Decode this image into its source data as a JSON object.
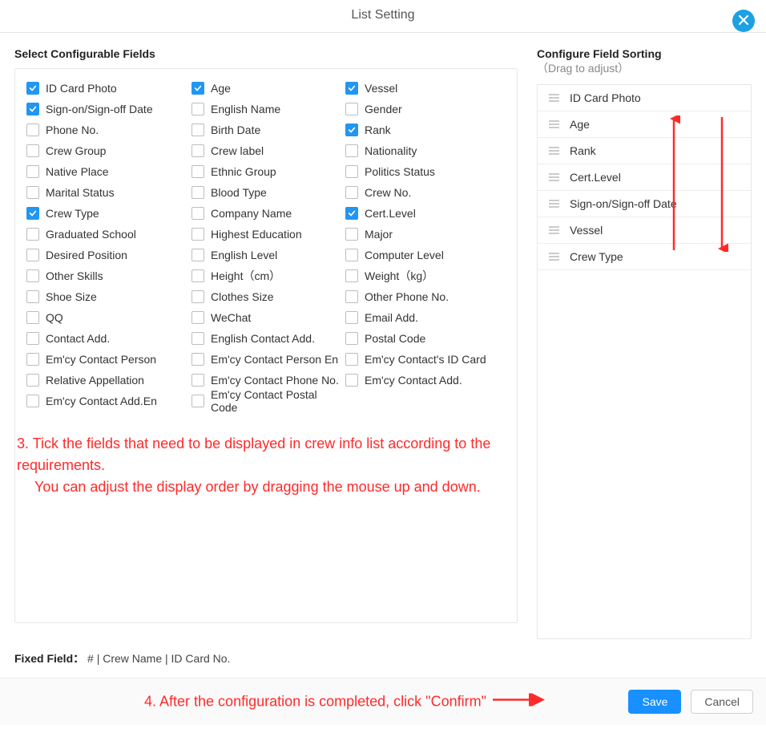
{
  "header": {
    "title": "List Setting"
  },
  "left": {
    "title": "Select Configurable Fields",
    "fields": [
      {
        "label": "ID Card Photo",
        "checked": true
      },
      {
        "label": "Age",
        "checked": true
      },
      {
        "label": "Vessel",
        "checked": true
      },
      {
        "label": "Sign-on/Sign-off Date",
        "checked": true
      },
      {
        "label": "English Name",
        "checked": false
      },
      {
        "label": "Gender",
        "checked": false
      },
      {
        "label": "Phone No.",
        "checked": false
      },
      {
        "label": "Birth Date",
        "checked": false
      },
      {
        "label": "Rank",
        "checked": true
      },
      {
        "label": "Crew Group",
        "checked": false
      },
      {
        "label": "Crew label",
        "checked": false
      },
      {
        "label": "Nationality",
        "checked": false
      },
      {
        "label": "Native Place",
        "checked": false
      },
      {
        "label": "Ethnic Group",
        "checked": false
      },
      {
        "label": "Politics Status",
        "checked": false
      },
      {
        "label": "Marital Status",
        "checked": false
      },
      {
        "label": "Blood Type",
        "checked": false
      },
      {
        "label": "Crew No.",
        "checked": false
      },
      {
        "label": "Crew Type",
        "checked": true
      },
      {
        "label": "Company Name",
        "checked": false
      },
      {
        "label": "Cert.Level",
        "checked": true
      },
      {
        "label": "Graduated School",
        "checked": false
      },
      {
        "label": "Highest Education",
        "checked": false
      },
      {
        "label": "Major",
        "checked": false
      },
      {
        "label": "Desired Position",
        "checked": false
      },
      {
        "label": "English Level",
        "checked": false
      },
      {
        "label": "Computer Level",
        "checked": false
      },
      {
        "label": "Other Skills",
        "checked": false
      },
      {
        "label": "Height（cm）",
        "checked": false
      },
      {
        "label": "Weight（kg）",
        "checked": false
      },
      {
        "label": "Shoe Size",
        "checked": false
      },
      {
        "label": "Clothes Size",
        "checked": false
      },
      {
        "label": "Other Phone No.",
        "checked": false
      },
      {
        "label": "QQ",
        "checked": false
      },
      {
        "label": "WeChat",
        "checked": false
      },
      {
        "label": "Email Add.",
        "checked": false
      },
      {
        "label": "Contact Add.",
        "checked": false
      },
      {
        "label": "English Contact Add.",
        "checked": false
      },
      {
        "label": "Postal Code",
        "checked": false
      },
      {
        "label": "Em'cy Contact Person",
        "checked": false
      },
      {
        "label": "Em'cy Contact Person En",
        "checked": false
      },
      {
        "label": "Em'cy Contact's ID Card",
        "checked": false
      },
      {
        "label": "Relative Appellation",
        "checked": false
      },
      {
        "label": "Em'cy Contact Phone No.",
        "checked": false
      },
      {
        "label": "Em'cy Contact Add.",
        "checked": false
      },
      {
        "label": "Em'cy Contact Add.En",
        "checked": false
      },
      {
        "label": "Em'cy Contact Postal Code",
        "checked": false
      }
    ]
  },
  "right": {
    "title": "Configure Field Sorting",
    "hint": "（Drag to adjust）",
    "items": [
      "ID Card Photo",
      "Age",
      "Rank",
      "Cert.Level",
      "Sign-on/Sign-off Date",
      "Vessel",
      "Crew Type"
    ]
  },
  "fixed_field": {
    "label": "Fixed Field：",
    "value": "# | Crew Name | ID Card No."
  },
  "footer": {
    "save": "Save",
    "cancel": "Cancel"
  },
  "annotations": {
    "step3_line1": "3. Tick the fields that need to be displayed in crew info list according to the requirements.",
    "step3_line2": "You can adjust the display order by dragging the mouse up and down.",
    "step4": "4. After the configuration is completed, click \"Confirm\""
  }
}
